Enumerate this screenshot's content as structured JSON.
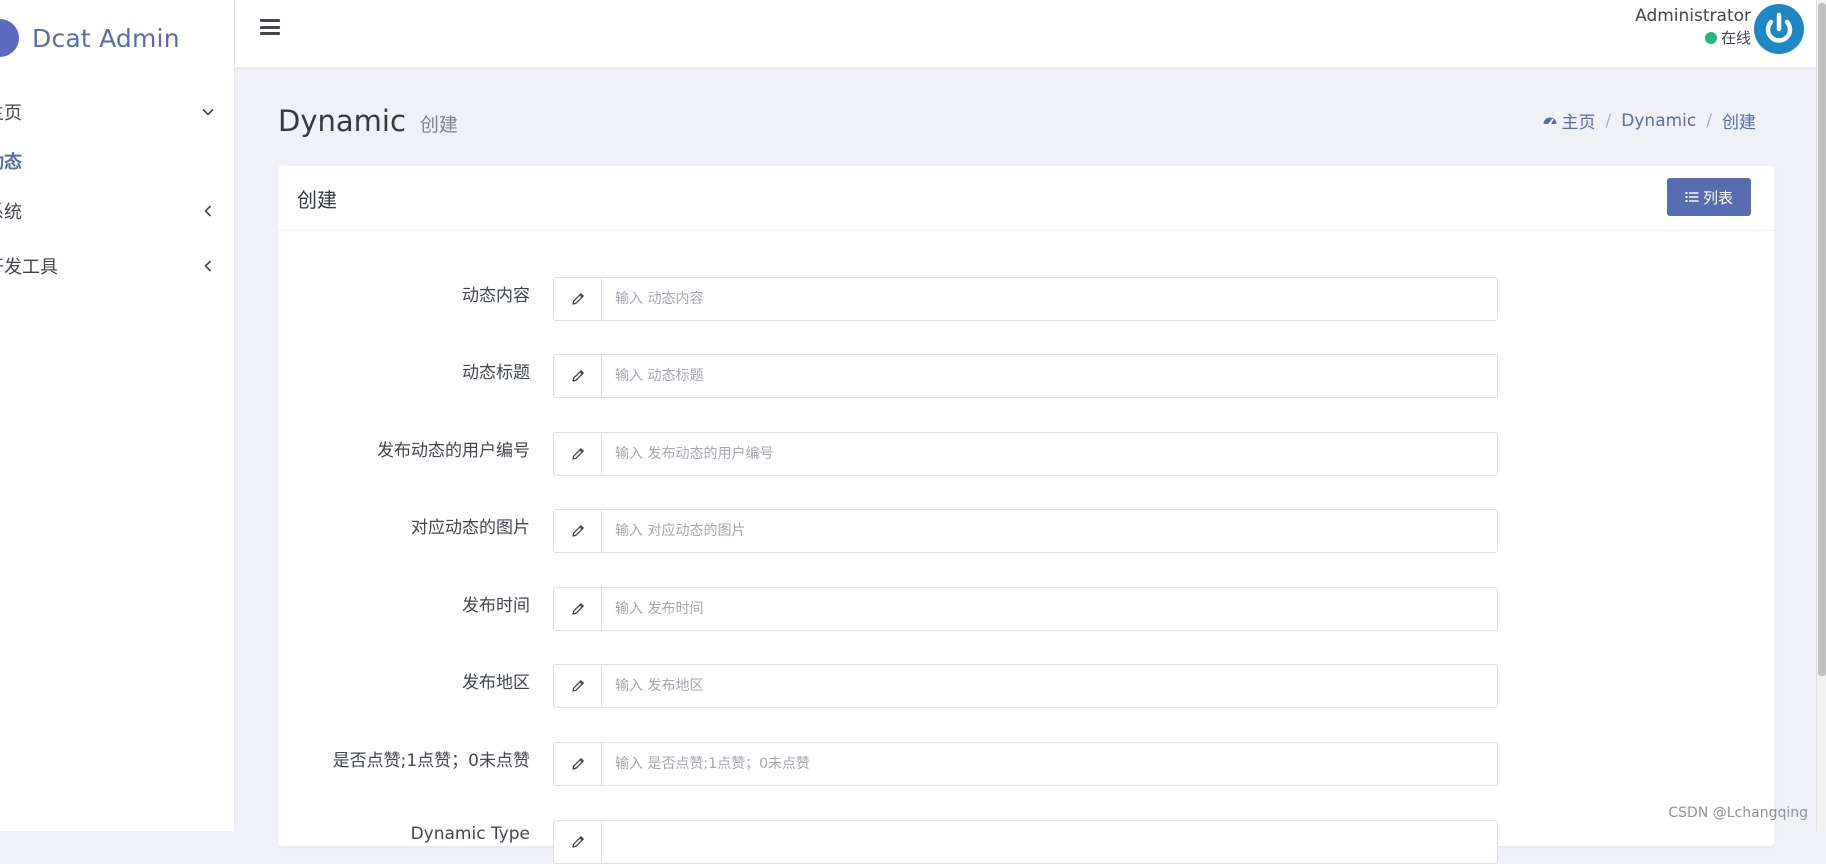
{
  "brand": {
    "name": "Dcat Admin"
  },
  "sidebar": {
    "items": [
      {
        "label": "主页",
        "caret": "chevron-down"
      },
      {
        "label": "动态",
        "active": true
      },
      {
        "label": "系统",
        "caret": "chevron-left"
      },
      {
        "label": "开发工具",
        "caret": "chevron-left"
      }
    ]
  },
  "header": {
    "user_name": "Administrator",
    "user_status": "在线"
  },
  "page": {
    "title": "Dynamic",
    "subtitle": "创建",
    "breadcrumb": [
      "主页",
      "Dynamic",
      "创建"
    ]
  },
  "card": {
    "title": "创建",
    "list_button": "列表"
  },
  "form": {
    "fields": [
      {
        "label": "动态内容",
        "placeholder": "输入 动态内容"
      },
      {
        "label": "动态标题",
        "placeholder": "输入 动态标题"
      },
      {
        "label": "发布动态的用户编号",
        "placeholder": "输入 发布动态的用户编号"
      },
      {
        "label": "对应动态的图片",
        "placeholder": "输入 对应动态的图片"
      },
      {
        "label": "发布时间",
        "placeholder": "输入 发布时间"
      },
      {
        "label": "发布地区",
        "placeholder": "输入 发布地区"
      },
      {
        "label": "是否点赞;1点赞；0未点赞",
        "placeholder": "输入 是否点赞;1点赞；0未点赞"
      },
      {
        "label": "Dynamic Type",
        "placeholder": ""
      }
    ]
  },
  "watermark": "CSDN @Lchangqing",
  "colors": {
    "primary": "#586cb1",
    "online": "#21b978",
    "avatar": "#1e88c7",
    "background": "#eff1f6"
  }
}
